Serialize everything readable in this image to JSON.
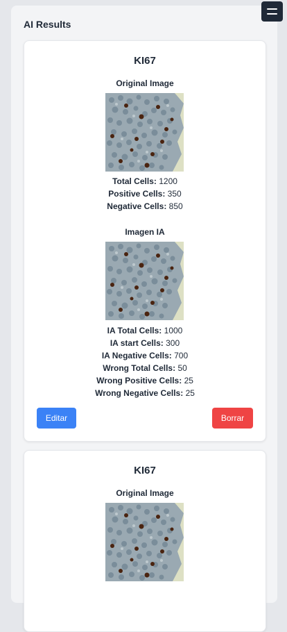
{
  "header": {
    "title": "AI Results",
    "menu_icon": "hamburger-menu-icon"
  },
  "results": [
    {
      "title": "KI67",
      "original": {
        "label": "Original Image",
        "image": "microscopy-image",
        "stats": [
          {
            "label": "Total Cells:",
            "value": "1200"
          },
          {
            "label": "Positive Cells:",
            "value": "350"
          },
          {
            "label": "Negative Cells:",
            "value": "850"
          }
        ]
      },
      "ai": {
        "label": "Imagen IA",
        "image": "microscopy-image",
        "stats": [
          {
            "label": "IA Total Cells:",
            "value": "1000"
          },
          {
            "label": "IA start Cells:",
            "value": "300"
          },
          {
            "label": "IA Negative Cells:",
            "value": "700"
          },
          {
            "label": "Wrong Total Cells:",
            "value": "50"
          },
          {
            "label": "Wrong Positive Cells:",
            "value": "25"
          },
          {
            "label": "Wrong Negative Cells:",
            "value": "25"
          }
        ]
      },
      "actions": {
        "edit_label": "Editar",
        "delete_label": "Borrar"
      }
    },
    {
      "title": "KI67",
      "original": {
        "label": "Original Image",
        "image": "microscopy-image"
      }
    }
  ],
  "colors": {
    "page_bg": "#e5e7eb",
    "panel_bg": "#f3f4f6",
    "edit_button": "#3b82f6",
    "delete_button": "#ef4444",
    "menu_button": "#1f2937"
  }
}
